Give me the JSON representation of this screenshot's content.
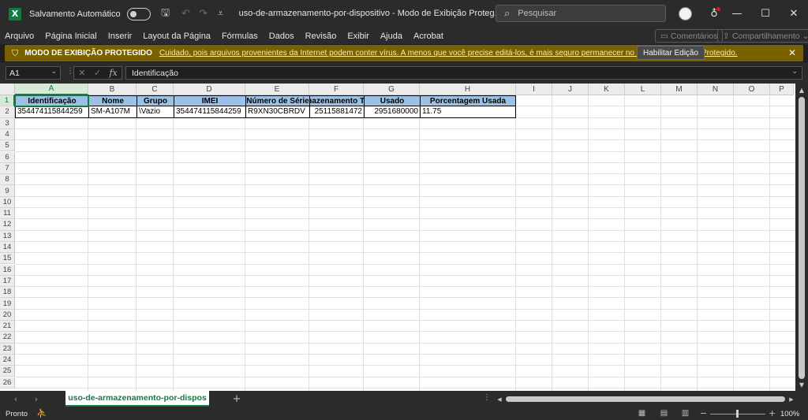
{
  "titlebar": {
    "app_icon": "excel-icon",
    "autosave_label": "Salvamento Automático",
    "doc_title": "uso-de-armazenamento-por-dispositivo  -  Modo de Exibição Proteg...  •  Salvo neste PC ⌵",
    "search_placeholder": "Pesquisar"
  },
  "menu": {
    "items": [
      "Arquivo",
      "Página Inicial",
      "Inserir",
      "Layout da Página",
      "Fórmulas",
      "Dados",
      "Revisão",
      "Exibir",
      "Ajuda",
      "Acrobat"
    ],
    "comments_label": "Comentários",
    "share_label": "Compartilhamento"
  },
  "protected_view": {
    "title": "MODO DE EXIBIÇÃO PROTEGIDO",
    "message": "Cuidado, pois arquivos provenientes da Internet podem conter vírus. A menos que você precise editá-los, é mais seguro permanecer no Modo de  Exibição Protegido.",
    "enable_button": "Habilitar Edição",
    "bar_color": "#7a6100"
  },
  "formula_bar": {
    "name_box": "A1",
    "formula": "Identificação"
  },
  "grid": {
    "columns": [
      "A",
      "B",
      "C",
      "D",
      "E",
      "F",
      "G",
      "H",
      "I",
      "J",
      "K",
      "L",
      "M",
      "N",
      "O",
      "P"
    ],
    "rows": [
      "1",
      "2",
      "3",
      "4",
      "5",
      "6",
      "7",
      "8",
      "9",
      "10",
      "11",
      "12",
      "13",
      "14",
      "15",
      "16",
      "17",
      "18",
      "19",
      "20",
      "21",
      "22",
      "23",
      "24",
      "25",
      "26"
    ],
    "header_row": [
      "Identificação",
      "Nome",
      "Grupo",
      "IMEI",
      "Número de Série",
      "mazenamento To",
      "Usado",
      "Porcentagem Usada"
    ],
    "data_row": [
      "354474115844259",
      "SM-A107M",
      "\\Vazio",
      "354474115844259",
      "R9XN30CBRDV",
      "25115881472",
      "2951680000",
      "11.75"
    ],
    "header_fill": "#9bc2e6"
  },
  "sheet_tabs": {
    "active": "uso-de-armazenamento-por-dispos"
  },
  "statusbar": {
    "status": "Pronto",
    "zoom": "100%"
  },
  "colors": {
    "accent": "#107c41",
    "chrome": "#2b2b2b"
  }
}
